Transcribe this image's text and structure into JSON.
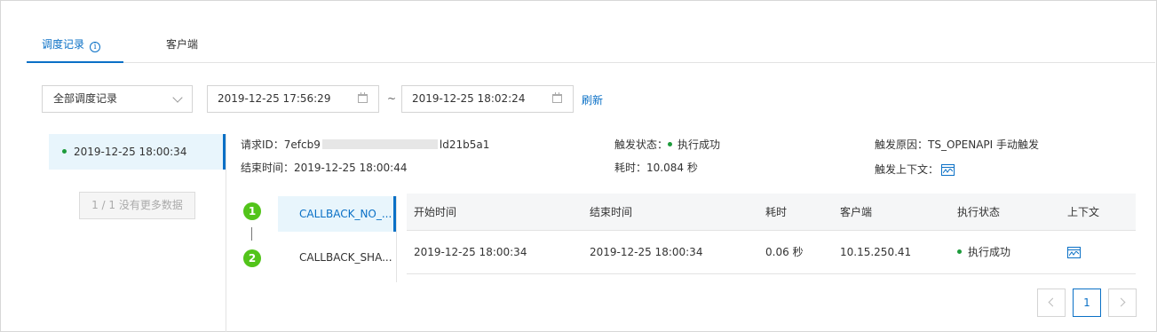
{
  "tabs": [
    {
      "label": "调度记录",
      "active": true
    },
    {
      "label": "客户端",
      "active": false
    }
  ],
  "filters": {
    "record_select": "全部调度记录",
    "start_date": "2019-12-25 17:56:29",
    "separator": "~",
    "end_date": "2019-12-25 18:02:24",
    "refresh_label": "刷新"
  },
  "records": {
    "items": [
      {
        "label": "2019-12-25 18:00:34",
        "status_color": "#1d9b3b"
      }
    ],
    "no_more_label": "1 / 1 没有更多数据"
  },
  "info": {
    "request_id_label": "请求ID：",
    "request_id_value": "7efcb9",
    "request_id_suffix": "ld21b5a1",
    "end_time_label": "结束时间：",
    "end_time_value": "2019-12-25 18:00:44",
    "trigger_status_label": "触发状态：",
    "trigger_status_value": "执行成功",
    "duration_label": "耗时：",
    "duration_value": "10.084 秒",
    "trigger_reason_label": "触发原因：",
    "trigger_reason_value": "TS_OPENAPI 手动触发",
    "trigger_context_label": "触发上下文："
  },
  "steps": [
    {
      "num": "1",
      "label": "CALLBACK_NO_...",
      "active": true
    },
    {
      "num": "2",
      "label": "CALLBACK_SHA...",
      "active": false
    }
  ],
  "table": {
    "columns": [
      "开始时间",
      "结束时间",
      "耗时",
      "客户端",
      "执行状态",
      "上下文"
    ],
    "rows": [
      {
        "start": "2019-12-25 18:00:34",
        "end": "2019-12-25 18:00:34",
        "duration": "0.06 秒",
        "client": "10.15.250.41",
        "status": "执行成功"
      }
    ]
  },
  "pagination": {
    "current": "1"
  },
  "colors": {
    "accent": "#0a70c6",
    "success": "#1d9b3b",
    "step": "#52c41a"
  }
}
